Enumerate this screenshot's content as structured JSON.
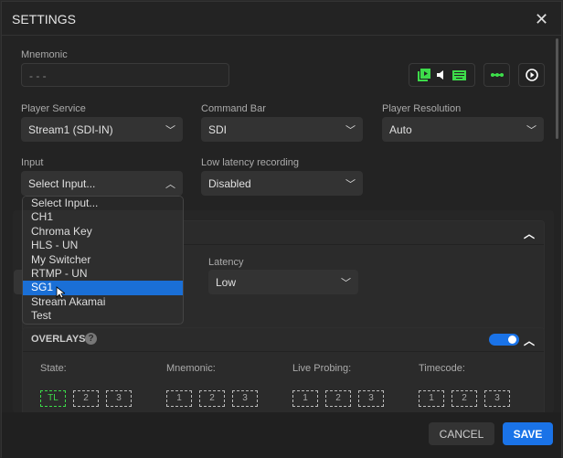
{
  "dialog": {
    "title": "SETTINGS",
    "close_icon": "close-icon"
  },
  "mnemonic": {
    "label": "Mnemonic",
    "value": "- - -"
  },
  "toolbar": {
    "icons": [
      "video-library-icon",
      "volume-icon",
      "keyboard-icon",
      "connection-icon",
      "play-circle-icon"
    ],
    "accent": "#3ddc4a"
  },
  "player_service": {
    "label": "Player Service",
    "value": "Stream1 (SDI-IN)"
  },
  "command_bar": {
    "label": "Command Bar",
    "value": "SDI"
  },
  "player_resolution": {
    "label": "Player Resolution",
    "value": "Auto"
  },
  "input": {
    "label": "Input",
    "value": "Select Input...",
    "options": [
      "Select Input...",
      "CH1",
      "Chroma Key",
      "HLS - UN",
      "My Switcher",
      "RTMP - UN",
      "SG1",
      "Stream Akamai",
      "Test"
    ],
    "highlighted": "SG1"
  },
  "low_latency": {
    "label": "Low latency recording",
    "value": "Disabled"
  },
  "latency": {
    "label": "Latency",
    "value": "Low"
  },
  "overlays": {
    "title": "OVERLAYS",
    "enabled": true,
    "groups": [
      {
        "label": "State:",
        "boxes": [
          "TL",
          "2",
          "3"
        ]
      },
      {
        "label": "Mnemonic:",
        "boxes": [
          "1",
          "2",
          "3"
        ]
      },
      {
        "label": "Live Probing:",
        "boxes": [
          "1",
          "2",
          "3"
        ]
      },
      {
        "label": "Timecode:",
        "boxes": [
          "1",
          "2",
          "3"
        ]
      }
    ]
  },
  "footer": {
    "cancel": "CANCEL",
    "save": "SAVE",
    "save_color": "#1a73e8"
  }
}
